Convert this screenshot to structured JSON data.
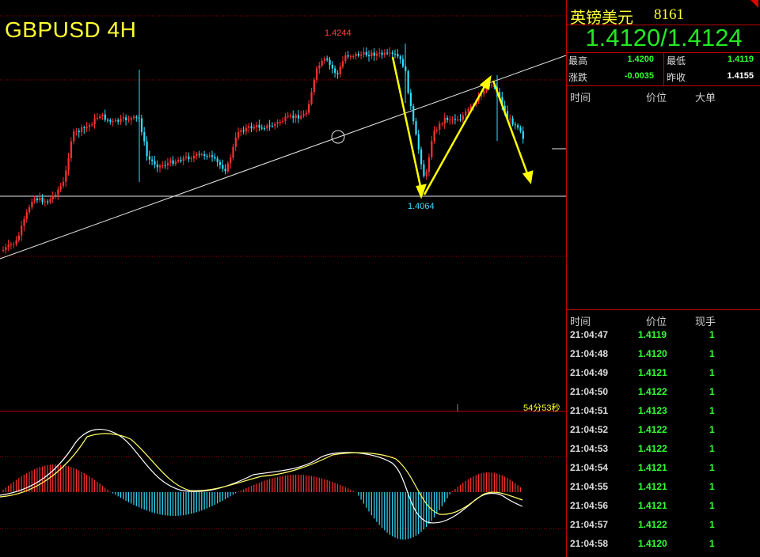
{
  "chart": {
    "symbol_title": "GBPUSD 4H",
    "high_label": "1.4244",
    "low_label": "1.4064",
    "timer": "54分53秒"
  },
  "quote": {
    "name": "英镑美元",
    "code": "8161",
    "bid_ask": "1.4120/1.4124",
    "stats": [
      {
        "label": "最高",
        "value": "1.4200",
        "color": "#33ff33"
      },
      {
        "label": "最低",
        "value": "1.4119",
        "color": "#33ff33"
      },
      {
        "label": "涨跌",
        "value": "-0.0035",
        "color": "#33ff33"
      },
      {
        "label": "昨收",
        "value": "1.4155",
        "color": "#ffffff"
      }
    ],
    "big_orders_headers": [
      "时间",
      "价位",
      "大单"
    ],
    "ticks_headers": [
      "时间",
      "价位",
      "现手"
    ],
    "ticks": [
      {
        "time": "21:04:47",
        "price": "1.4119",
        "vol": "1"
      },
      {
        "time": "21:04:48",
        "price": "1.4120",
        "vol": "1"
      },
      {
        "time": "21:04:49",
        "price": "1.4121",
        "vol": "1"
      },
      {
        "time": "21:04:50",
        "price": "1.4122",
        "vol": "1"
      },
      {
        "time": "21:04:51",
        "price": "1.4123",
        "vol": "1"
      },
      {
        "time": "21:04:52",
        "price": "1.4122",
        "vol": "1"
      },
      {
        "time": "21:04:53",
        "price": "1.4122",
        "vol": "1"
      },
      {
        "time": "21:04:54",
        "price": "1.4121",
        "vol": "1"
      },
      {
        "time": "21:04:55",
        "price": "1.4121",
        "vol": "1"
      },
      {
        "time": "21:04:56",
        "price": "1.4121",
        "vol": "1"
      },
      {
        "time": "21:04:57",
        "price": "1.4122",
        "vol": "1"
      },
      {
        "time": "21:04:58",
        "price": "1.4120",
        "vol": "1"
      }
    ]
  },
  "colors": {
    "up": "#ff3030",
    "down": "#30e0ff",
    "grid": "#a00000",
    "arrow": "#ffff00",
    "accent": "#ffff33",
    "price_green": "#22e822"
  }
}
